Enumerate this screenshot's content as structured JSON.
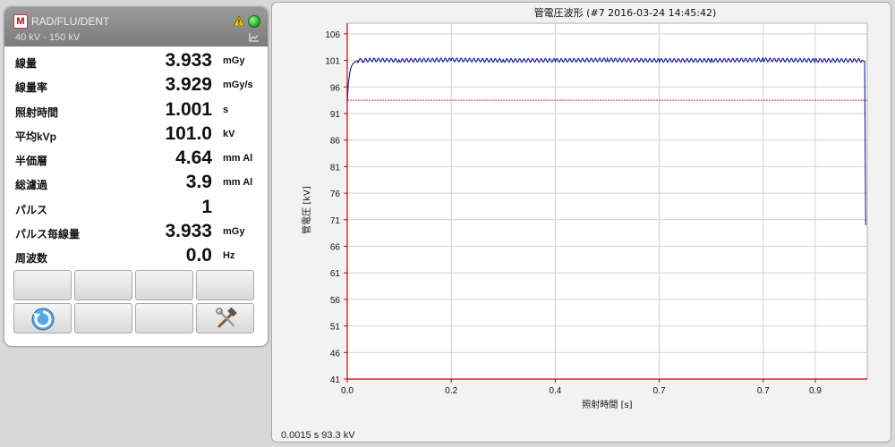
{
  "panel": {
    "logo_letter": "M",
    "mode": "RAD/FLU/DENT",
    "range": "40 kV - 150 kV",
    "readings": [
      {
        "label": "線量",
        "value": "3.933",
        "unit": "mGy"
      },
      {
        "label": "線量率",
        "value": "3.929",
        "unit": "mGy/s"
      },
      {
        "label": "照射時間",
        "value": "1.001",
        "unit": "s"
      },
      {
        "label": "平均kVp",
        "value": "101.0",
        "unit": "kV"
      },
      {
        "label": "半価層",
        "value": "4.64",
        "unit": "mm Al"
      },
      {
        "label": "総濾過",
        "value": "3.9",
        "unit": "mm Al"
      },
      {
        "label": "パルス",
        "value": "1",
        "unit": ""
      },
      {
        "label": "パルス毎線量",
        "value": "3.933",
        "unit": "mGy"
      },
      {
        "label": "周波数",
        "value": "0.0",
        "unit": "Hz"
      }
    ]
  },
  "colors": {
    "trace": "#1a1aa0",
    "threshold": "#e03030",
    "axis_red": "#cc0000",
    "grid": "#d2d2d2"
  },
  "chart_data": {
    "type": "line",
    "title": "管電圧波形 (#7   2016-03-24  14:45:42)",
    "xlabel": "照射時間 [s]",
    "ylabel": "管電圧 [kV]",
    "xlim": [
      0.0,
      1.0
    ],
    "ylim": [
      41,
      108
    ],
    "xticks": [
      0.0,
      0.2,
      0.4,
      0.6,
      0.8,
      0.9
    ],
    "xtick_labels": [
      "0.0",
      "0.2",
      "0.4",
      "0.7",
      "0.7",
      "0.9"
    ],
    "yticks": [
      106,
      101,
      96,
      91,
      86,
      81,
      76,
      71,
      66,
      61,
      56,
      51,
      46,
      41
    ],
    "grid": true,
    "threshold_kv": 93.5,
    "series": [
      {
        "x": [
          0.0,
          0.002,
          0.005,
          0.008,
          0.012,
          0.016,
          0.02,
          0.025,
          0.03,
          0.05,
          0.1,
          0.2,
          0.3,
          0.4,
          0.5,
          0.6,
          0.7,
          0.8,
          0.9,
          0.99,
          0.995,
          0.996,
          0.997
        ],
        "y": [
          93.3,
          96.5,
          98.8,
          99.9,
          100.5,
          100.8,
          100.9,
          101.0,
          101.0,
          101.1,
          101.0,
          101.1,
          101.0,
          101.0,
          101.1,
          101.0,
          101.0,
          101.1,
          101.0,
          101.0,
          100.8,
          85.0,
          70.0
        ]
      }
    ]
  },
  "readout": "0.0015 s  93.3 kV"
}
